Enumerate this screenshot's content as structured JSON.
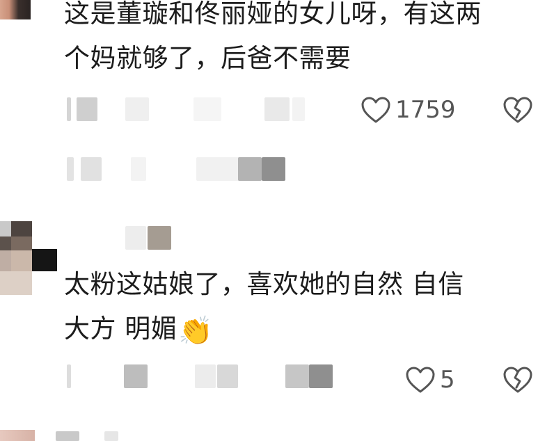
{
  "comments": [
    {
      "text_line1": "这是董璇和佟丽娅的女儿呀，有这两",
      "text_line2": "个妈就够了，后爸不需要",
      "like_count": "1759"
    },
    {
      "text_line1": "太粉这姑娘了，喜欢她的自然 自信",
      "text_line2": "大方 明媚",
      "emoji": "👏",
      "like_count": "5"
    }
  ],
  "icons": {
    "like": "heart-outline-icon",
    "dislike": "broken-heart-icon",
    "clap": "clapping-hands-emoji"
  },
  "colors": {
    "text": "#1c1c1c",
    "icon": "#555555",
    "background": "#ffffff"
  }
}
